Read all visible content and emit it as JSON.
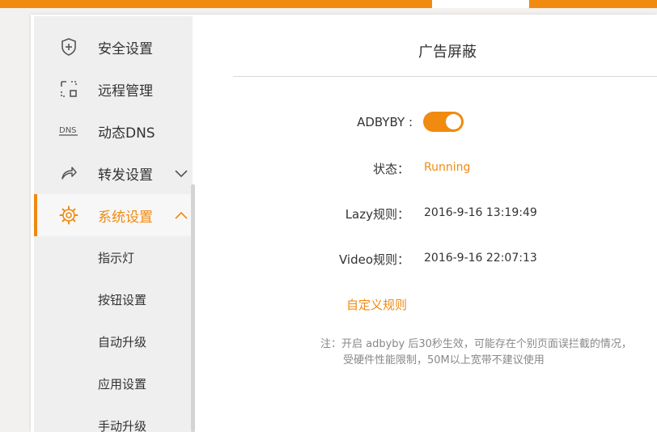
{
  "colors": {
    "accent": "#f08a10",
    "sidebar_bg": "#efefef",
    "page_bg": "#f3f1ef"
  },
  "sidebar": {
    "items": [
      {
        "label": "安全设置",
        "icon": "shield-plus-icon"
      },
      {
        "label": "远程管理",
        "icon": "remote-manage-icon"
      },
      {
        "label": "动态DNS",
        "icon": "dns-icon"
      },
      {
        "label": "转发设置",
        "icon": "share-arrow-icon",
        "expandable": true,
        "expanded": false
      },
      {
        "label": "系统设置",
        "icon": "gear-icon",
        "expandable": true,
        "expanded": true,
        "active": true
      }
    ],
    "sub_items": [
      {
        "label": "指示灯"
      },
      {
        "label": "按钮设置"
      },
      {
        "label": "自动升级"
      },
      {
        "label": "应用设置"
      },
      {
        "label": "手动升级"
      }
    ]
  },
  "main": {
    "title": "广告屏蔽",
    "adbyby_label": "ADBYBY :",
    "adbyby_enabled": true,
    "status_label": "状态：",
    "status_value": "Running",
    "lazy_label": "Lazy规则：",
    "lazy_value": "2016-9-16 13:19:49",
    "video_label": "Video规则：",
    "video_value": "2016-9-16 22:07:13",
    "custom_rules_link": "自定义规则",
    "note_line1": "注：开启 adbyby 后30秒生效，可能存在个别页面误拦截的情况，",
    "note_line2": "受硬件性能限制，50M以上宽带不建议使用"
  }
}
